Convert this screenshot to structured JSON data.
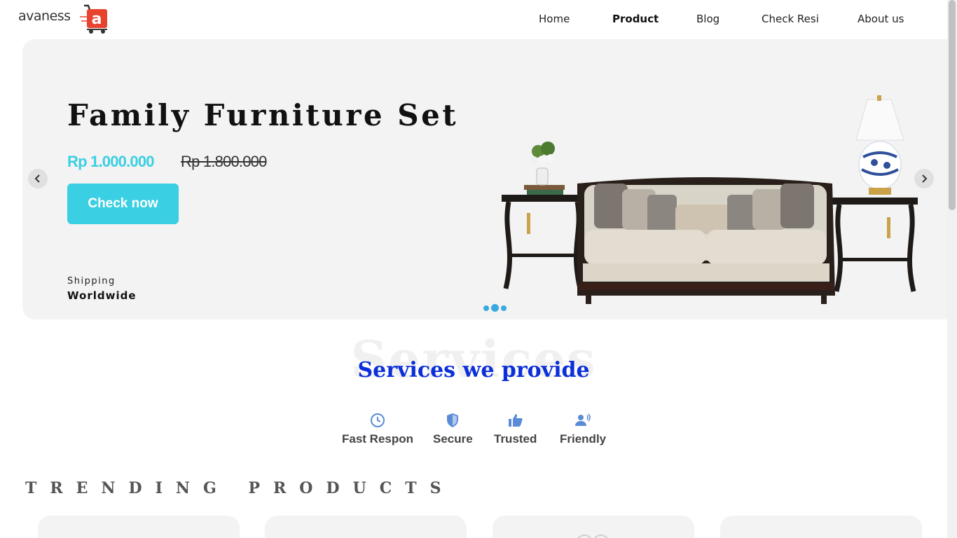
{
  "brand": {
    "name": "avaness",
    "mark": "a"
  },
  "nav": {
    "items": [
      {
        "label": "Home"
      },
      {
        "label": "Product",
        "active": true
      },
      {
        "label": "Blog"
      },
      {
        "label": "Check Resi"
      },
      {
        "label": "About us"
      }
    ]
  },
  "hero": {
    "title": "Family Furniture Set",
    "price_new": "Rp 1.000.000",
    "price_old": "Rp 1.800.000",
    "cta_label": "Check now",
    "shipping_label": "Shipping",
    "shipping_value": "Worldwide",
    "slide_count": 3,
    "active_slide": 2,
    "image_icon": "sofa-with-side-tables-image"
  },
  "services": {
    "background_text": "Services",
    "title": "Services we provide",
    "items": [
      {
        "label": "Fast Respon",
        "icon": "clock-icon"
      },
      {
        "label": "Secure",
        "icon": "shield-icon"
      },
      {
        "label": "Trusted",
        "icon": "thumbs-up-icon"
      },
      {
        "label": "Friendly",
        "icon": "person-voice-icon"
      }
    ]
  },
  "trending": {
    "title": "TRENDING PRODUCTS"
  },
  "colors": {
    "accent": "#3acfe3",
    "services_title": "#0b2fd8",
    "icon": "#5a8bd8",
    "logo_red": "#e8432e"
  }
}
